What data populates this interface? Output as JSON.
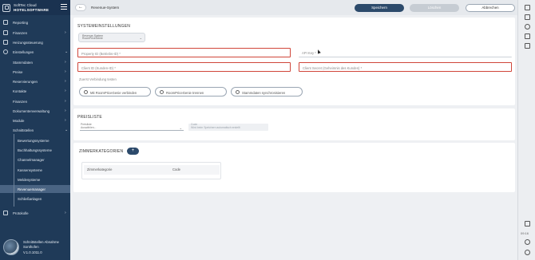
{
  "app": {
    "name_line1": "SoftTec Cloud",
    "name_line2": "HOTELSOFTWARE"
  },
  "sidebar": {
    "items": [
      {
        "label": "Reporting",
        "icon": "chart-icon",
        "chevron": ""
      },
      {
        "label": "Finanzen",
        "icon": "finance-icon",
        "chevron": "›"
      },
      {
        "label": "Heizungssteuerung",
        "icon": "heating-icon",
        "chevron": ""
      },
      {
        "label": "Einstellungen",
        "icon": "gear-icon",
        "chevron": "⌄"
      },
      {
        "label": "Stammdaten",
        "chevron": "›"
      },
      {
        "label": "Preise",
        "chevron": "›"
      },
      {
        "label": "Reservierungen",
        "chevron": "›"
      },
      {
        "label": "Kontakte",
        "chevron": "›"
      },
      {
        "label": "Finanzen",
        "chevron": "›"
      },
      {
        "label": "Dokumentenverwaltung",
        "chevron": "›"
      },
      {
        "label": "Module",
        "chevron": "›"
      },
      {
        "label": "Schnittstellen",
        "chevron": "⌄"
      },
      {
        "label": "Bewertungssysteme"
      },
      {
        "label": "Buchhaltungssysteme"
      },
      {
        "label": "Channelmanager"
      },
      {
        "label": "Kassensysteme"
      },
      {
        "label": "Meldesysteme"
      },
      {
        "label": "Revenuemanager"
      },
      {
        "label": "Schließanlagen"
      },
      {
        "label": "Protokolle",
        "icon": "log-icon",
        "chevron": "›"
      }
    ],
    "user": {
      "line1": "Schnittstellen Abnahme",
      "line2": "Sonthofen",
      "version": "V.1.0.1011.0"
    }
  },
  "topbar": {
    "back_symbol": "←",
    "page_name": "Revenue-System",
    "save_label": "Speichern",
    "delete_label": "Löschen",
    "cancel_label": "Abbrechen"
  },
  "settings": {
    "title": "SYSTEMEINSTELLUNGEN",
    "system_select_label": "Revenue-System",
    "system_select_value": "RoomPriceGenie",
    "property_id_placeholder": "Property ID (Betriebs-ID) *",
    "api_key_placeholder": "API Key *",
    "client_id_placeholder": "Client ID (Kunden-ID) *",
    "client_secret_placeholder": "Client Secret (Geheimnis des Kunden) *",
    "hint": "Zuerst Verbindung testen",
    "btn_connect": "Mit RoomPriceGenie verbinden",
    "btn_disconnect": "RoomPriceGenie trennen",
    "btn_sync": "Stammdaten synchronisieren"
  },
  "pricelist": {
    "title": "PREISLISTE",
    "select_label": "Preisliste",
    "select_value": "Auswählen...",
    "disabled_label": "Code",
    "disabled_value": "Wird beim Speichern automatisch erstellt"
  },
  "rooms": {
    "title": "ZIMMERKATEGORIEN",
    "add_symbol": "+",
    "col_category": "Zimmerkategorie",
    "col_code": "Code"
  },
  "rail": {
    "time": "09:16"
  },
  "colors": {
    "sidebar": "#1f3a58",
    "primary": "#2c4a6b",
    "required_border": "#d0463a"
  }
}
